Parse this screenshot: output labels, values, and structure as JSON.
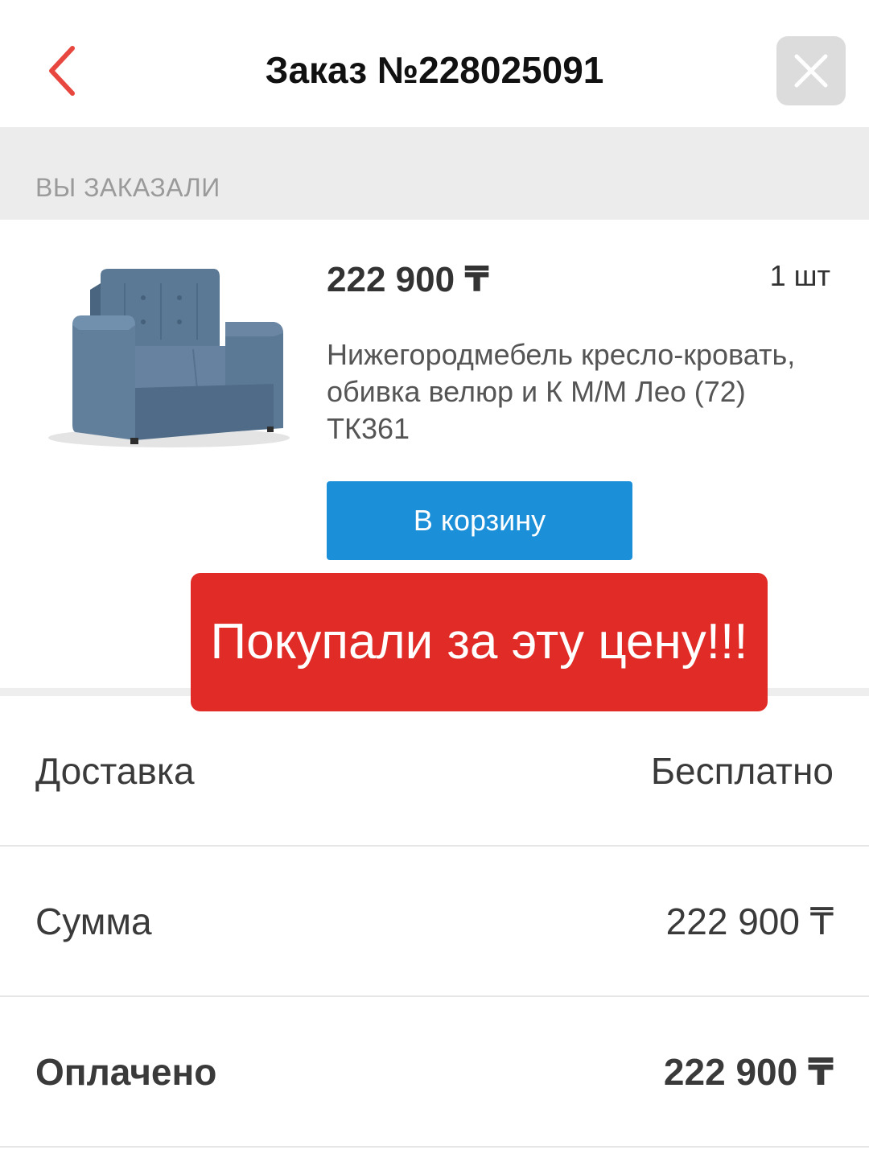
{
  "header": {
    "title": "Заказ №228025091"
  },
  "section": {
    "label": "ВЫ ЗАКАЗАЛИ"
  },
  "product": {
    "price": "222 900 ₸",
    "quantity": "1 шт",
    "name": "Нижегородмебель кресло-кровать, обивка велюр и К М/М Лео (72) ТК361",
    "cart_label": "В корзину",
    "image_icon": "armchair-image"
  },
  "banner": {
    "text": "Покупали за эту цену!!!"
  },
  "summary": {
    "delivery_label": "Доставка",
    "delivery_value": "Бесплатно",
    "sum_label": "Сумма",
    "sum_value": "222 900 ₸",
    "paid_label": "Оплачено",
    "paid_value": "222 900 ₸"
  },
  "colors": {
    "accent_red": "#e02b27",
    "button_blue": "#1b8fd8",
    "back_arrow": "#e8473f"
  }
}
